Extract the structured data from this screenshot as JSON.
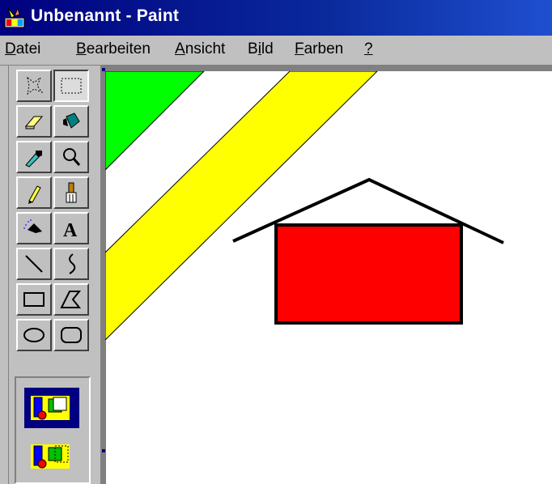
{
  "window": {
    "title": "Unbenannt - Paint",
    "titlebar_color": "#000080"
  },
  "menu": {
    "items": [
      {
        "accel": "D",
        "rest": "atei"
      },
      {
        "accel": "B",
        "rest": "earbeiten"
      },
      {
        "accel": "A",
        "rest": "nsicht"
      },
      {
        "accel": "",
        "pre": "B",
        "accel2": "i",
        "rest": "ld"
      },
      {
        "accel": "F",
        "rest": "arben"
      },
      {
        "accel": "?",
        "rest": ""
      }
    ]
  },
  "toolbox": {
    "tools": [
      {
        "name": "free-form-select-icon",
        "pressed": false
      },
      {
        "name": "select-icon",
        "pressed": true
      },
      {
        "name": "eraser-icon",
        "pressed": false
      },
      {
        "name": "fill-with-color-icon",
        "pressed": false
      },
      {
        "name": "pick-color-icon",
        "pressed": false
      },
      {
        "name": "magnifier-icon",
        "pressed": false
      },
      {
        "name": "pencil-icon",
        "pressed": false
      },
      {
        "name": "brush-icon",
        "pressed": false
      },
      {
        "name": "airbrush-icon",
        "pressed": false
      },
      {
        "name": "text-icon",
        "pressed": false
      },
      {
        "name": "line-icon",
        "pressed": false
      },
      {
        "name": "curve-icon",
        "pressed": false
      },
      {
        "name": "rectangle-icon",
        "pressed": false
      },
      {
        "name": "polygon-icon",
        "pressed": false
      },
      {
        "name": "ellipse-icon",
        "pressed": false
      },
      {
        "name": "rounded-rectangle-icon",
        "pressed": false
      }
    ],
    "text_tool_glyph": "A",
    "options": [
      {
        "name": "opaque-selection-option",
        "selected": true
      },
      {
        "name": "transparent-selection-option",
        "selected": false
      }
    ]
  },
  "drawing": {
    "colors": {
      "green_stripe": "#00ff00",
      "yellow_stripe": "#ffff00",
      "house_body": "#ff0000",
      "outline": "#000000",
      "canvas": "#ffffff"
    }
  }
}
